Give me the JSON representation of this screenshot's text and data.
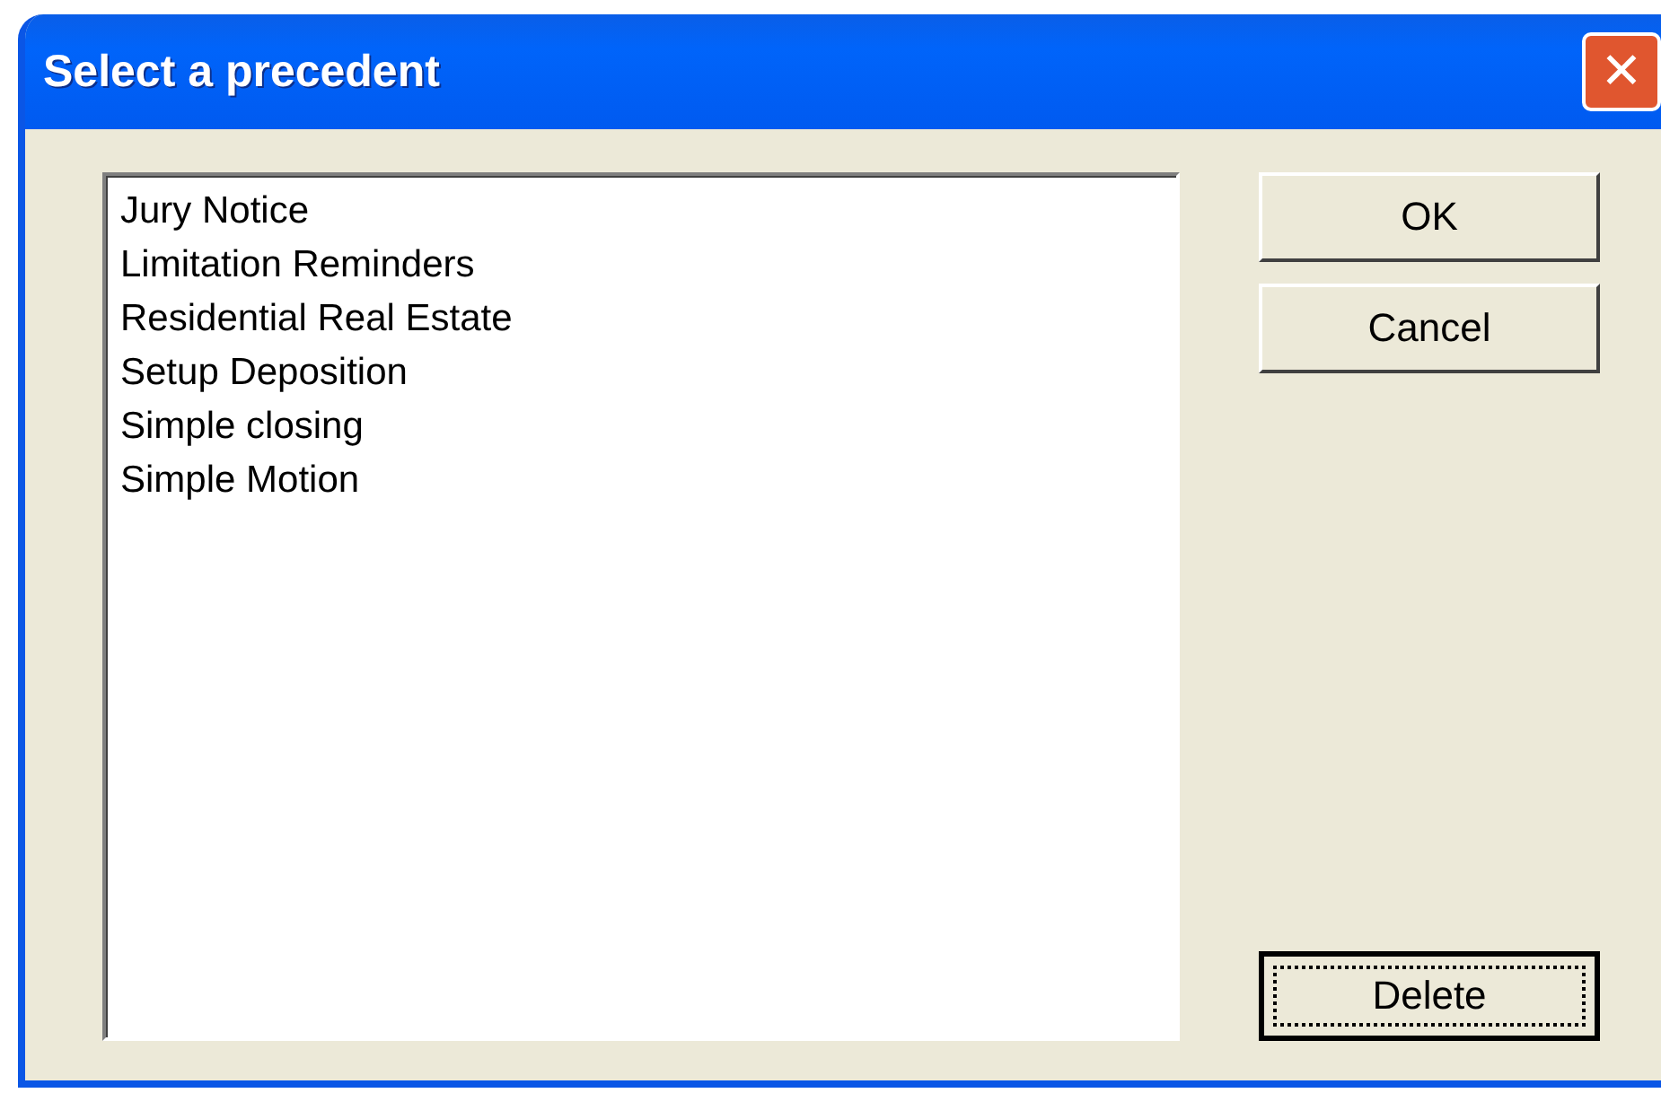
{
  "window": {
    "title": "Select a precedent",
    "close": "✕"
  },
  "list": {
    "items": [
      {
        "label": "Jury Notice",
        "selected": false
      },
      {
        "label": "Limitation Reminders",
        "selected": false
      },
      {
        "label": "Residential Real Estate",
        "selected": false
      },
      {
        "label": "Setup Deposition",
        "selected": false
      },
      {
        "label": "Simple closing",
        "selected": false
      },
      {
        "label": "Simple Motion",
        "selected": false
      }
    ]
  },
  "buttons": [
    {
      "label": "OK",
      "focused": false
    },
    {
      "label": "Cancel",
      "focused": false
    }
  ],
  "bottom_buttons": [
    {
      "label": "Delete",
      "focused": true
    }
  ]
}
